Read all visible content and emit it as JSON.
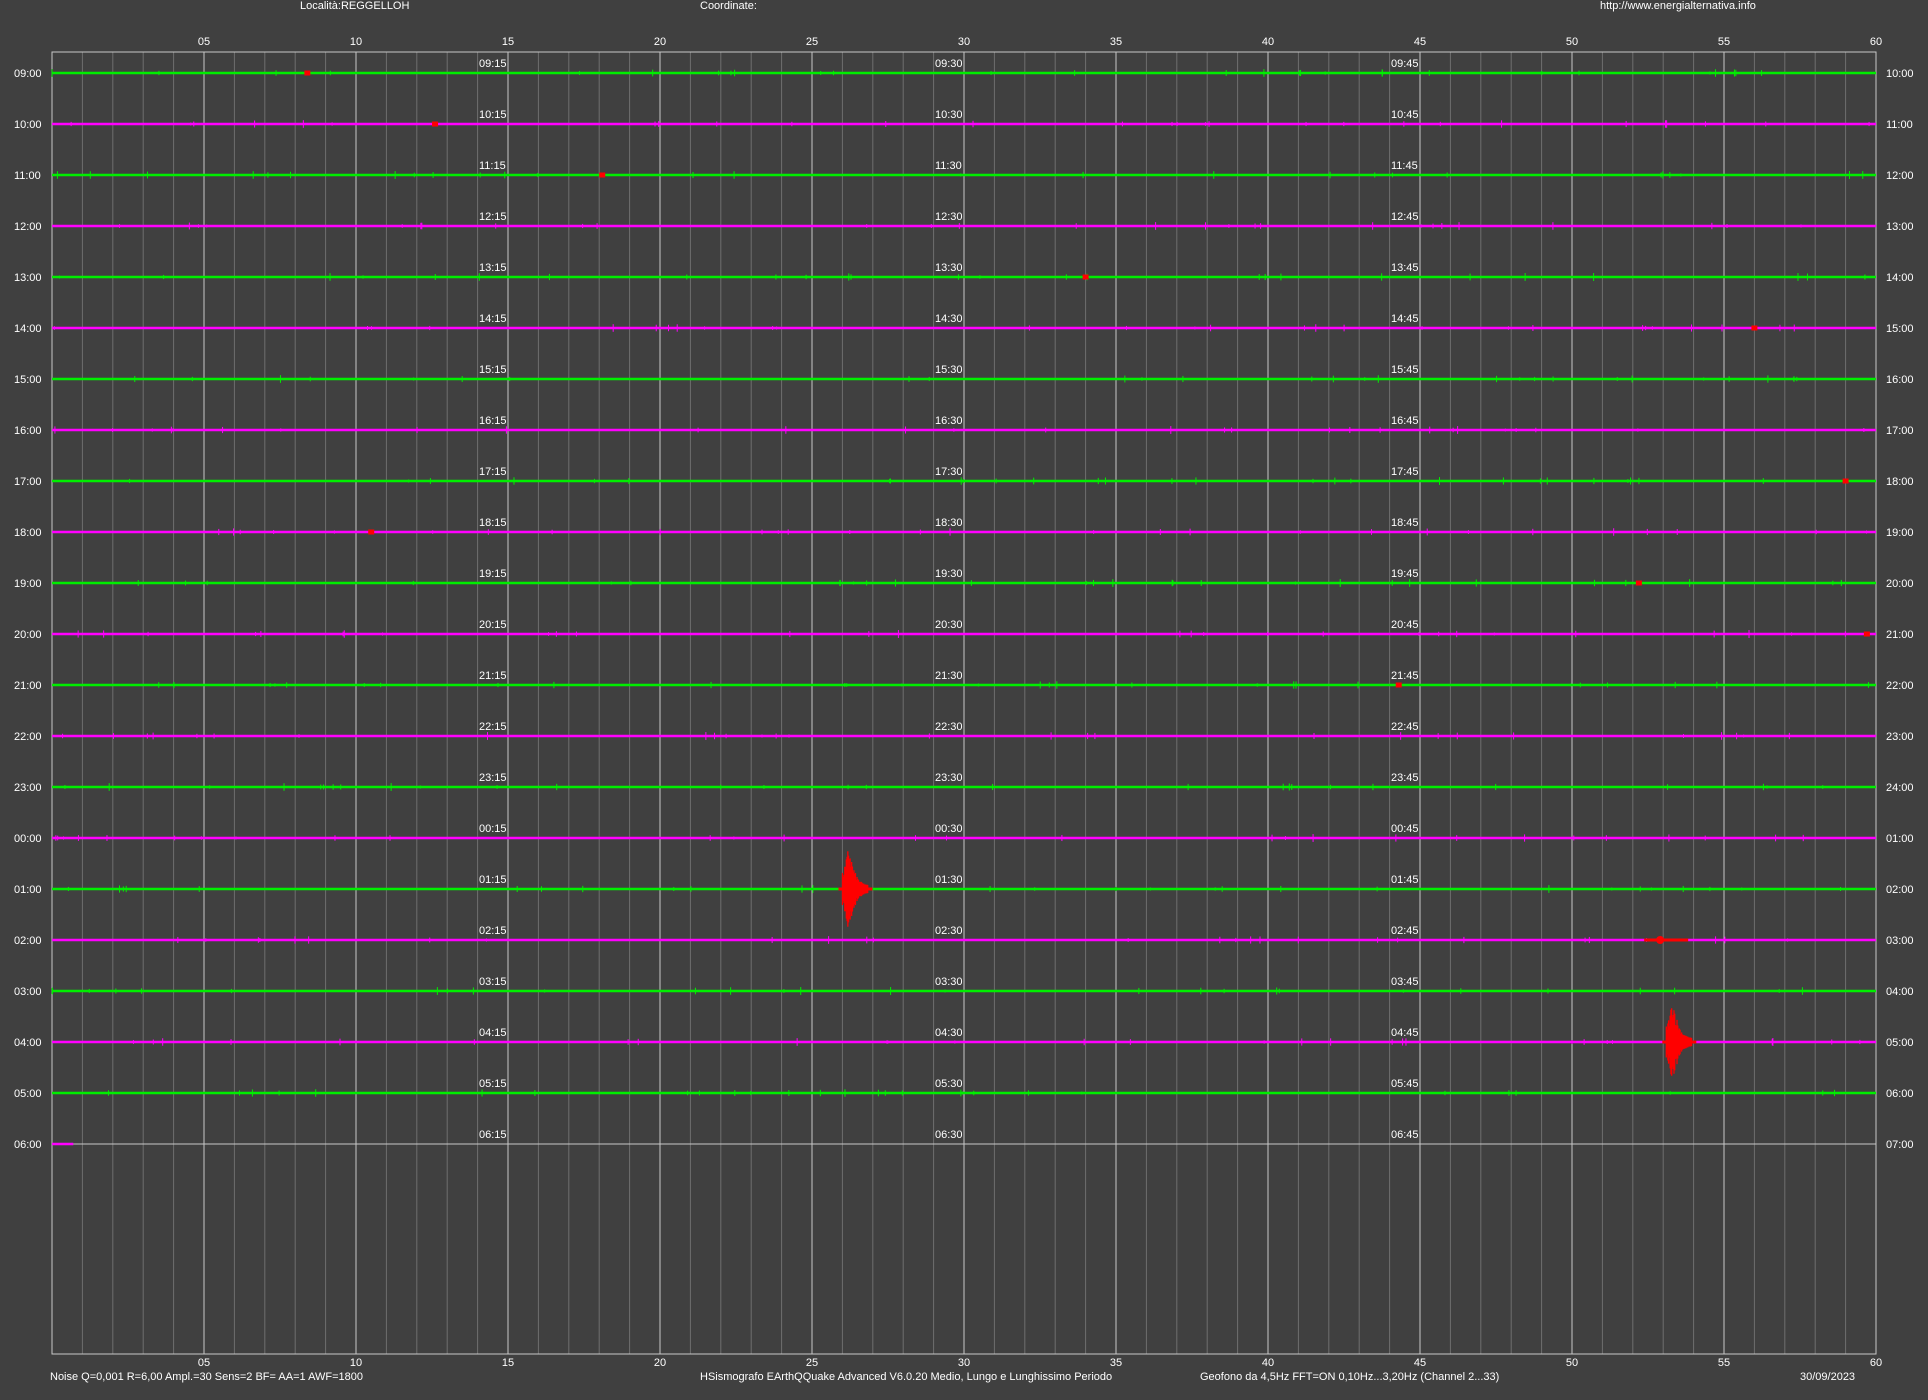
{
  "header": {
    "locality": "Località:REGGELLOH",
    "coordinates": "Coordinate:",
    "url": "http://www.energialternativa.info"
  },
  "footer": {
    "params": "Noise Q=0,001 R=6,00 Ampl.=30 Sens=2 BF= AA=1 AWF=1800",
    "software": "HSismografo  EArthQQuake Advanced V6.0.20  Medio, Lungo e Lunghissimo Periodo",
    "sensor": "Geofono da 4,5Hz FFT=ON 0,10Hz...3,20Hz      (Channel 2...33)",
    "date": "30/09/2023"
  },
  "colors": {
    "background": "#404040",
    "grid_major": "#c8c8c8",
    "grid_minor": "#6e6e6e",
    "trace_a": "#00ee00",
    "trace_b": "#ff00ff",
    "event": "#ff0000",
    "text": "#ffffff"
  },
  "chart_data": {
    "type": "helicorder",
    "x_unit": "minutes",
    "xlim": [
      0,
      60
    ],
    "x_ticks": [
      "05",
      "10",
      "15",
      "20",
      "25",
      "30",
      "35",
      "40",
      "45",
      "50",
      "55",
      "60"
    ],
    "rows": [
      {
        "start": "09:00",
        "end": "10:00",
        "q1": "09:15",
        "q2": "09:30",
        "q3": "09:45",
        "color": "trace_a",
        "complete": true
      },
      {
        "start": "10:00",
        "end": "11:00",
        "q1": "10:15",
        "q2": "10:30",
        "q3": "10:45",
        "color": "trace_b",
        "complete": true
      },
      {
        "start": "11:00",
        "end": "12:00",
        "q1": "11:15",
        "q2": "11:30",
        "q3": "11:45",
        "color": "trace_a",
        "complete": true
      },
      {
        "start": "12:00",
        "end": "13:00",
        "q1": "12:15",
        "q2": "12:30",
        "q3": "12:45",
        "color": "trace_b",
        "complete": true
      },
      {
        "start": "13:00",
        "end": "14:00",
        "q1": "13:15",
        "q2": "13:30",
        "q3": "13:45",
        "color": "trace_a",
        "complete": true
      },
      {
        "start": "14:00",
        "end": "15:00",
        "q1": "14:15",
        "q2": "14:30",
        "q3": "14:45",
        "color": "trace_b",
        "complete": true
      },
      {
        "start": "15:00",
        "end": "16:00",
        "q1": "15:15",
        "q2": "15:30",
        "q3": "15:45",
        "color": "trace_a",
        "complete": true
      },
      {
        "start": "16:00",
        "end": "17:00",
        "q1": "16:15",
        "q2": "16:30",
        "q3": "16:45",
        "color": "trace_b",
        "complete": true
      },
      {
        "start": "17:00",
        "end": "18:00",
        "q1": "17:15",
        "q2": "17:30",
        "q3": "17:45",
        "color": "trace_a",
        "complete": true
      },
      {
        "start": "18:00",
        "end": "19:00",
        "q1": "18:15",
        "q2": "18:30",
        "q3": "18:45",
        "color": "trace_b",
        "complete": true
      },
      {
        "start": "19:00",
        "end": "20:00",
        "q1": "19:15",
        "q2": "19:30",
        "q3": "19:45",
        "color": "trace_a",
        "complete": true
      },
      {
        "start": "20:00",
        "end": "21:00",
        "q1": "20:15",
        "q2": "20:30",
        "q3": "20:45",
        "color": "trace_b",
        "complete": true
      },
      {
        "start": "21:00",
        "end": "22:00",
        "q1": "21:15",
        "q2": "21:30",
        "q3": "21:45",
        "color": "trace_a",
        "complete": true
      },
      {
        "start": "22:00",
        "end": "23:00",
        "q1": "22:15",
        "q2": "22:30",
        "q3": "22:45",
        "color": "trace_b",
        "complete": true
      },
      {
        "start": "23:00",
        "end": "24:00",
        "q1": "23:15",
        "q2": "23:30",
        "q3": "23:45",
        "color": "trace_a",
        "complete": true
      },
      {
        "start": "00:00",
        "end": "01:00",
        "q1": "00:15",
        "q2": "00:30",
        "q3": "00:45",
        "color": "trace_b",
        "complete": true
      },
      {
        "start": "01:00",
        "end": "02:00",
        "q1": "01:15",
        "q2": "01:30",
        "q3": "01:45",
        "color": "trace_a",
        "complete": true
      },
      {
        "start": "02:00",
        "end": "03:00",
        "q1": "02:15",
        "q2": "02:30",
        "q3": "02:45",
        "color": "trace_b",
        "complete": true
      },
      {
        "start": "03:00",
        "end": "04:00",
        "q1": "03:15",
        "q2": "03:30",
        "q3": "03:45",
        "color": "trace_a",
        "complete": true
      },
      {
        "start": "04:00",
        "end": "05:00",
        "q1": "04:15",
        "q2": "04:30",
        "q3": "04:45",
        "color": "trace_b",
        "complete": true
      },
      {
        "start": "05:00",
        "end": "06:00",
        "q1": "05:15",
        "q2": "05:30",
        "q3": "05:45",
        "color": "trace_a",
        "complete": true
      },
      {
        "start": "06:00",
        "end": "07:00",
        "q1": "06:15",
        "q2": "06:30",
        "q3": "06:45",
        "color": "trace_b",
        "complete": false,
        "recorded_minutes": 0.7
      }
    ],
    "events": [
      {
        "row": "01:00",
        "minute": 26.2,
        "magnitude": "large"
      },
      {
        "row": "04:00",
        "minute": 53.3,
        "magnitude": "large"
      },
      {
        "row": "02:00",
        "minute": 52.9,
        "magnitude": "small"
      },
      {
        "row": "09:00",
        "minute": 8.4,
        "magnitude": "tiny"
      },
      {
        "row": "10:00",
        "minute": 12.6,
        "magnitude": "tiny"
      },
      {
        "row": "11:00",
        "minute": 18.1,
        "magnitude": "tiny"
      },
      {
        "row": "13:00",
        "minute": 34.0,
        "magnitude": "tiny"
      },
      {
        "row": "14:00",
        "minute": 56.0,
        "magnitude": "tiny"
      },
      {
        "row": "17:00",
        "minute": 59.0,
        "magnitude": "tiny"
      },
      {
        "row": "18:00",
        "minute": 10.5,
        "magnitude": "tiny"
      },
      {
        "row": "19:00",
        "minute": 52.2,
        "magnitude": "tiny"
      },
      {
        "row": "20:00",
        "minute": 59.7,
        "magnitude": "tiny"
      },
      {
        "row": "21:00",
        "minute": 44.3,
        "magnitude": "tiny"
      }
    ]
  }
}
